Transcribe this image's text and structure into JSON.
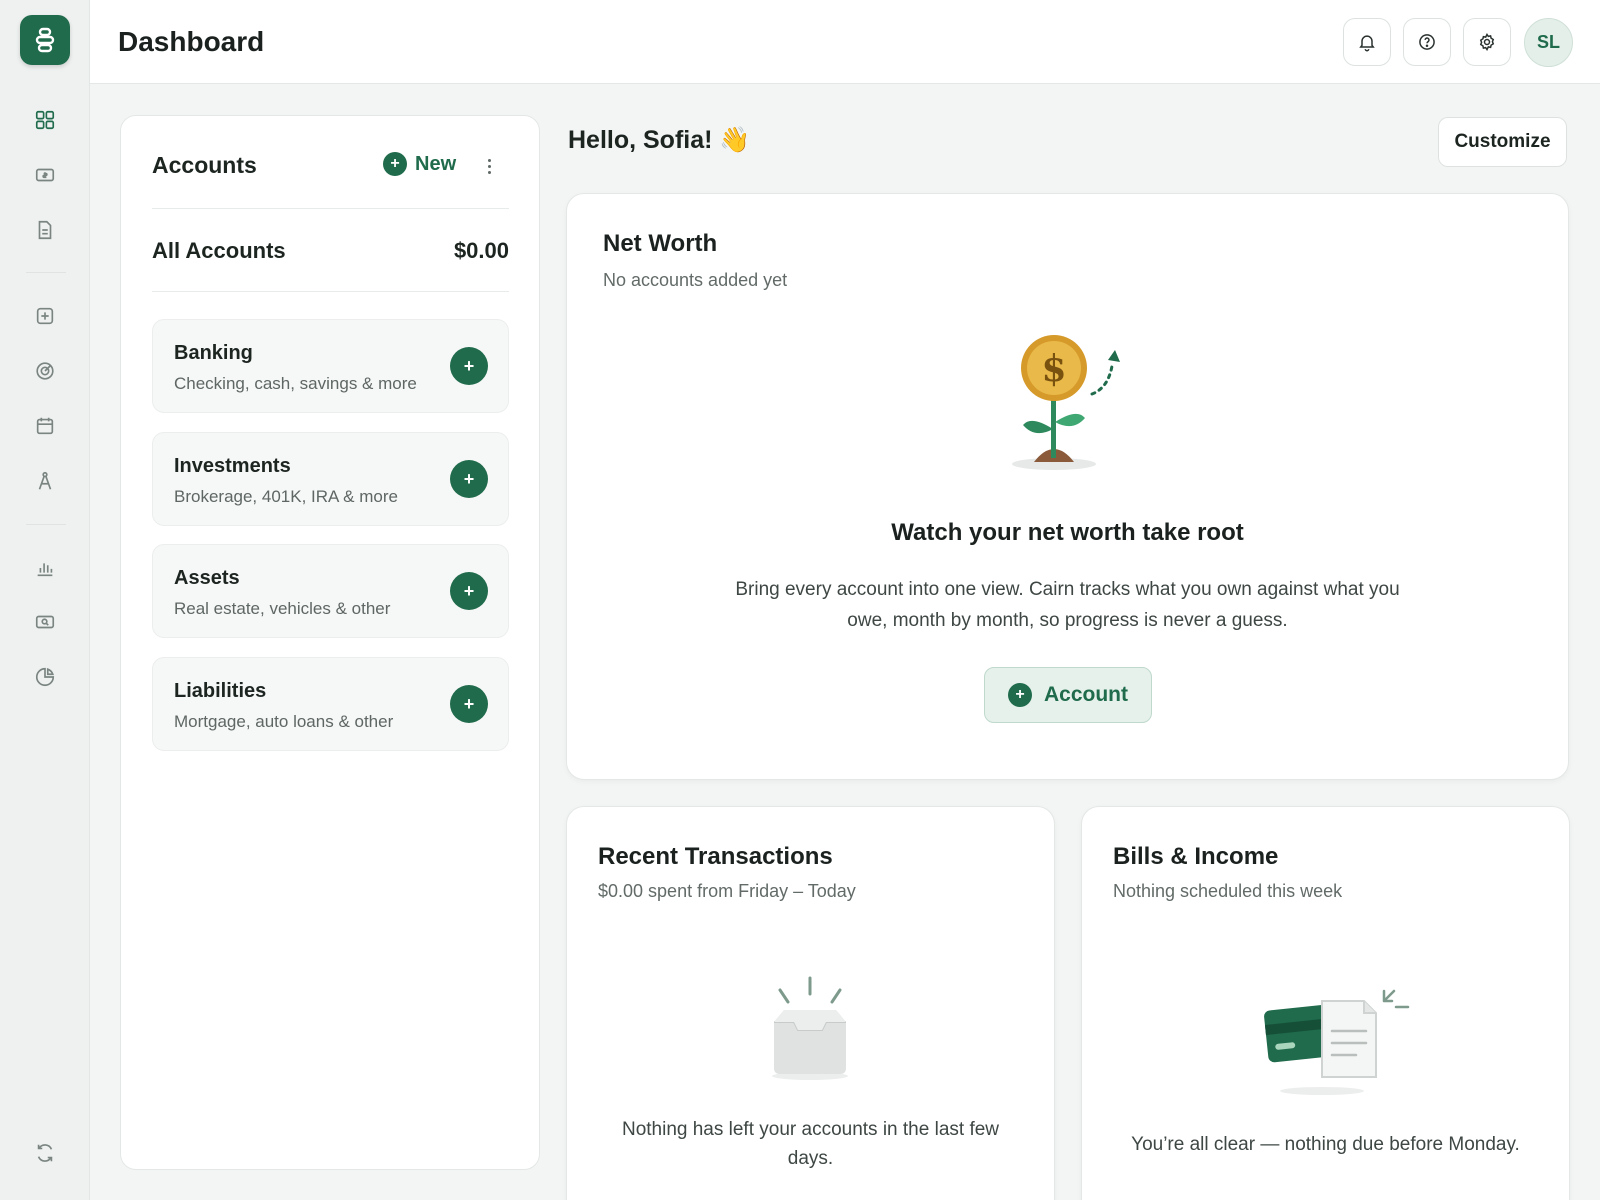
{
  "header": {
    "title": "Dashboard",
    "user_initials": "SL"
  },
  "sidebar": {
    "icons": [
      "dashboard-icon",
      "money-icon",
      "document-icon",
      "add-square-icon",
      "target-icon",
      "calendar-icon",
      "compass-icon",
      "bar-chart-icon",
      "search-money-icon",
      "pie-chart-icon",
      "sync-icon"
    ]
  },
  "accounts": {
    "title": "Accounts",
    "new_label": "New",
    "all_label": "All Accounts",
    "all_amount": "$0.00",
    "categories": [
      {
        "name": "Banking",
        "desc": "Checking, cash, savings & more"
      },
      {
        "name": "Investments",
        "desc": "Brokerage, 401K, IRA & more"
      },
      {
        "name": "Assets",
        "desc": "Real estate, vehicles & other"
      },
      {
        "name": "Liabilities",
        "desc": "Mortgage, auto loans & other"
      }
    ]
  },
  "main": {
    "greeting": "Hello, Sofia! 👋",
    "customize_label": "Customize"
  },
  "net_worth": {
    "title": "Net Worth",
    "subtitle": "No accounts added yet",
    "heading": "Watch your net worth take root",
    "body_line1": "Bring every account into one view. Cairn tracks what you own against what you",
    "body_line2": "owe, month by month, so progress is never a guess.",
    "button_label": "Account"
  },
  "transactions": {
    "title": "Recent Transactions",
    "subtitle": "$0.00 spent from Friday – Today",
    "empty_line1": "Nothing has left your accounts in the last few",
    "empty_line2": "days."
  },
  "bills": {
    "title": "Bills & Income",
    "subtitle": "Nothing scheduled this week",
    "empty_text": "You’re all clear — nothing due before Monday."
  },
  "colors": {
    "brand": "#1f6b4c",
    "accent_light": "#e6f1ec",
    "coin": "#e9b949"
  }
}
